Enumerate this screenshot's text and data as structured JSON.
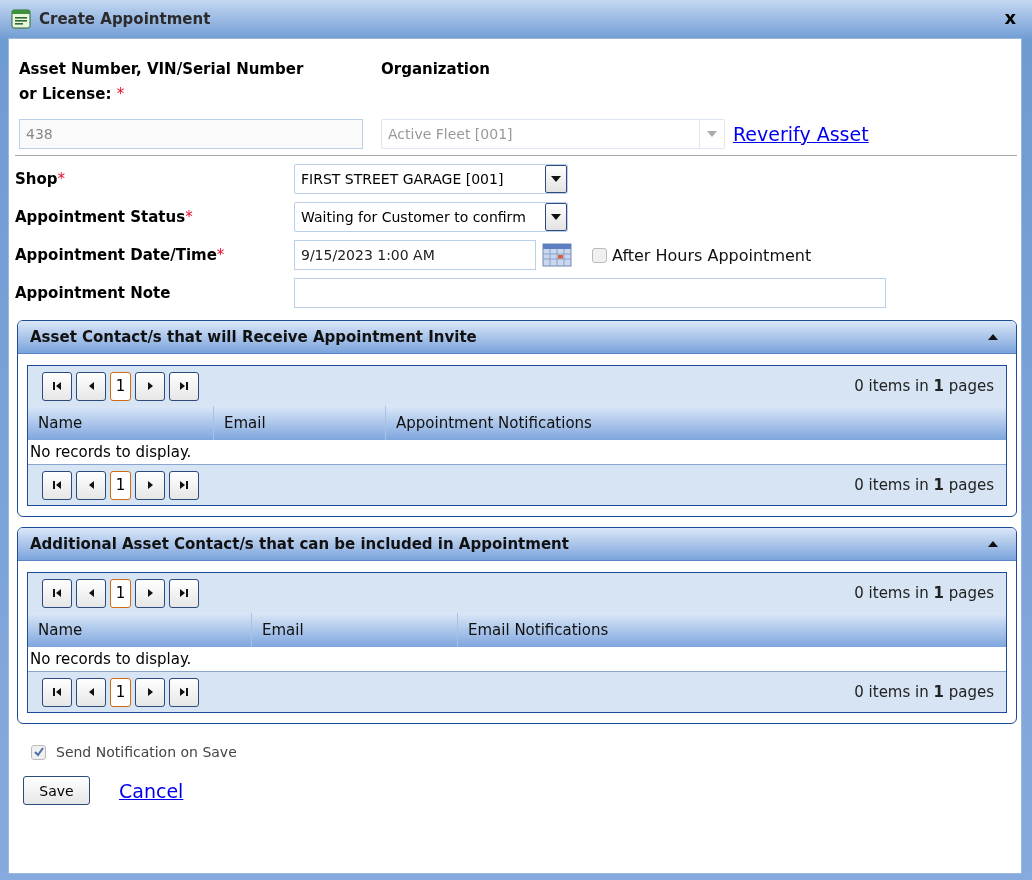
{
  "window": {
    "title": "Create Appointment",
    "close": "x"
  },
  "asset": {
    "label": "Asset Number, VIN/Serial Number or License:",
    "required_mark": "*",
    "value": "438",
    "disabled": true
  },
  "organization": {
    "label": "Organization",
    "value": "Active Fleet [001]",
    "disabled": true
  },
  "reverify_link": "Reverify Asset",
  "fields": [
    {
      "kind": "dropdown",
      "label": "Shop",
      "required_mark": "*",
      "value": "FIRST STREET GARAGE [001]"
    },
    {
      "kind": "dropdown",
      "label": "Appointment Status",
      "required_mark": "*",
      "value": "Waiting for Customer to confirm"
    },
    {
      "kind": "datetime",
      "label": "Appointment Date/Time",
      "required_mark": "*",
      "value": "9/15/2023 1:00 AM",
      "checkbox": {
        "label": "After Hours Appointment",
        "checked": false,
        "disabled": true
      }
    },
    {
      "kind": "text",
      "label": "Appointment Note"
    }
  ],
  "panels": [
    {
      "title": "Asset Contact/s that will Receive Appointment Invite",
      "expanded": true,
      "columns": [
        "Name",
        "Email",
        "Appointment Notifications"
      ],
      "empty_message": "No records to display.",
      "pagers": [
        {
          "page": "1",
          "selected": true,
          "summary": "0 items in **1** pages"
        },
        {
          "page": "1",
          "selected": true,
          "summary": "0 items in **1** pages"
        }
      ]
    },
    {
      "title": "Additional Asset Contact/s that can be included in Appointment",
      "expanded": true,
      "columns": [
        "Name",
        "Email",
        "Email Notifications"
      ],
      "empty_message": "No records to display.",
      "pagers": [
        {
          "page": "1",
          "selected": true,
          "summary": "0 items in **1** pages"
        },
        {
          "page": "1",
          "selected": true,
          "summary": "0 items in **1** pages"
        }
      ]
    }
  ],
  "send_notification": {
    "label": "Send Notification on Save",
    "checked": true,
    "disabled": true
  },
  "buttons": {
    "save": "Save",
    "cancel": "Cancel"
  }
}
